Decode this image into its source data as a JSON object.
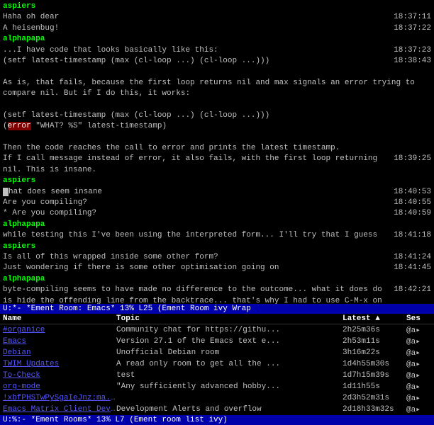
{
  "chat": {
    "messages": [
      {
        "type": "username",
        "user": "aspiers",
        "lines": [
          {
            "text": "Haha oh dear",
            "timestamp": "18:37:11"
          },
          {
            "text": "A heisenbug!",
            "timestamp": "18:37:22"
          }
        ]
      },
      {
        "type": "username",
        "user": "alphapapa",
        "lines": [
          {
            "text": "...I have code that looks basically like this:",
            "timestamp": "18:37:23"
          },
          {
            "text": "(setf latest-timestamp (max (cl-loop ...) (cl-loop ...)))",
            "timestamp": "18:38:43",
            "code": true
          }
        ]
      },
      {
        "type": "plain",
        "text": "",
        "timestamp": ""
      },
      {
        "type": "plain",
        "text": "As is, that fails, because the first loop returns nil and max signals an error trying to compare nil. But if I do this, it works:",
        "timestamp": ""
      },
      {
        "type": "plain",
        "text": "",
        "timestamp": ""
      },
      {
        "type": "code-block",
        "lines": [
          {
            "text": "(setf latest-timestamp (max (cl-loop ...) (cl-loop ...)))",
            "error": false
          },
          {
            "text": "(error \"WHAT? %S\" latest-timestamp)",
            "error": true,
            "error_word": "error"
          }
        ]
      },
      {
        "type": "plain",
        "text": "",
        "timestamp": ""
      },
      {
        "type": "plain",
        "text": "Then the code reaches the call to error and prints the latest timestamp.",
        "timestamp": ""
      },
      {
        "type": "plain",
        "text": "If I call message instead of error, it also fails, with the first loop returning nil. This is insane.",
        "timestamp": "18:39:25"
      },
      {
        "type": "username",
        "user": "aspiers",
        "lines": [
          {
            "text": "That does seem insane",
            "timestamp": "18:40:53",
            "cursor": true
          },
          {
            "text": "Are you compiling?",
            "timestamp": "18:40:55"
          },
          {
            "text": " * Are you compiling?",
            "timestamp": "18:40:59"
          }
        ]
      },
      {
        "type": "username",
        "user": "alphapapa",
        "lines": [
          {
            "text": "while testing this I've been using the interpreted form... I'll try that I guess",
            "timestamp": "18:41:18"
          }
        ]
      },
      {
        "type": "username",
        "user": "aspiers",
        "lines": [
          {
            "text": "Is all of this wrapped inside some other form?",
            "timestamp": "18:41:24"
          },
          {
            "text": "Just wondering if there is some other optimisation going on",
            "timestamp": "18:41:45"
          }
        ]
      },
      {
        "type": "username",
        "user": "alphapapa",
        "lines": [
          {
            "text": "byte-compiling seems to have made no difference to the outcome... what it does do is hide the offending line from the backtrace... that's why I had to use C-M-x on the defun",
            "timestamp": "18:42:21"
          }
        ]
      }
    ],
    "status_bar": "U:*-  *Ement Room: Emacs*  13% L25  (Ement Room ivy Wrap"
  },
  "room_list": {
    "headers": {
      "name": "Name",
      "topic": "Topic",
      "latest": "Latest ▲",
      "ses": "Ses"
    },
    "rooms": [
      {
        "name": "#organice",
        "topic": "Community chat for https://githu...",
        "latest": "2h25m36s",
        "ses": "@a▸"
      },
      {
        "name": "Emacs",
        "topic": "Version 27.1 of the Emacs text e...",
        "latest": "2h53m11s",
        "ses": "@a▸"
      },
      {
        "name": "Debian",
        "topic": "Unofficial Debian room",
        "latest": "3h16m22s",
        "ses": "@a▸"
      },
      {
        "name": "TWIM Updates",
        "topic": "A read only room to get all the ...",
        "latest": "1d4h55m30s",
        "ses": "@a▸"
      },
      {
        "name": "To-Check",
        "topic": "test",
        "latest": "1d7h15m39s",
        "ses": "@a▸"
      },
      {
        "name": "org-mode",
        "topic": "\"Any sufficiently advanced hobby...",
        "latest": "1d11h55s",
        "ses": "@a▸"
      },
      {
        "name": "!xbfPHSTwPySgaIeJnz:ma...",
        "topic": "",
        "latest": "2d3h52m31s",
        "ses": "@a▸"
      },
      {
        "name": "Emacs Matrix Client Dev...",
        "topic": "Development Alerts and overflow",
        "latest": "2d18h33m32s",
        "ses": "@a▸"
      }
    ],
    "status_bar": "U:%:-  *Ement Rooms*  13% L7  (Ement room list ivy)"
  }
}
